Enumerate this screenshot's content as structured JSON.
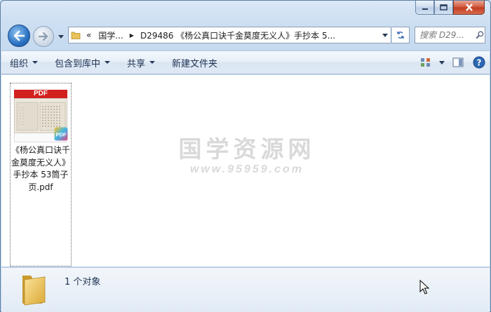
{
  "window": {
    "caption_buttons": [
      "minimize",
      "maximize",
      "close"
    ]
  },
  "address_bar": {
    "overflow": "«",
    "segments": [
      "国学...",
      "D29486 《杨公真口诀千金莫度无义人》手抄本 5..."
    ],
    "search_placeholder": "搜索 D29..."
  },
  "toolbar": {
    "organize": "组织",
    "include_in_library": "包含到库中",
    "share": "共享",
    "new_folder": "新建文件夹"
  },
  "files": [
    {
      "name": "《杨公真口诀千金莫度无义人》手抄本 53筒子页.pdf",
      "thumb_banner": "PDF",
      "badge": "PDF"
    }
  ],
  "watermark": {
    "main": "国学资源网",
    "sub": "www.95959.com"
  },
  "status": {
    "count_text": "1 个对象"
  },
  "colors": {
    "pdf_red": "#d2201f",
    "chrome_blue": "#cfe0f3",
    "back_button": "#2c73c4"
  }
}
